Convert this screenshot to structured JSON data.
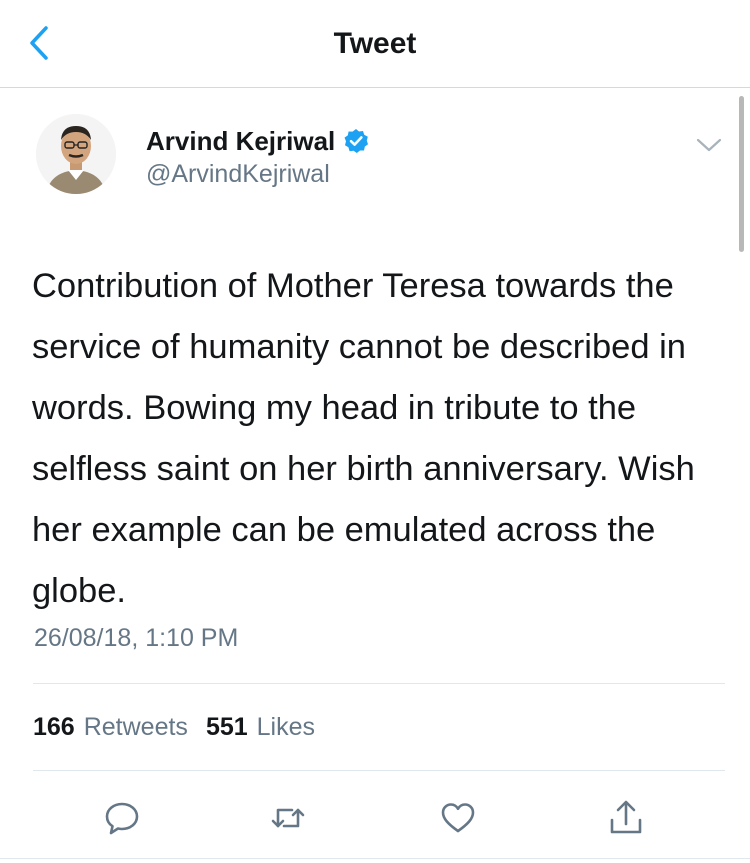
{
  "nav": {
    "title": "Tweet"
  },
  "author": {
    "name": "Arvind Kejriwal",
    "handle": "@ArvindKejriwal",
    "verified": true
  },
  "tweet": {
    "text": "Contribution of Mother Teresa towards the service of humanity cannot be described in words. Bowing my head in tribute to the selfless saint on her birth anniversary. Wish her example can be emulated across the globe.",
    "timestamp": "26/08/18, 1:10 PM"
  },
  "stats": {
    "retweets_count": "166",
    "retweets_label": "Retweets",
    "likes_count": "551",
    "likes_label": "Likes"
  },
  "actions": [
    "reply-icon",
    "retweet-icon",
    "like-icon",
    "share-icon"
  ],
  "colors": {
    "accent": "#1da1f2",
    "text": "#14171a",
    "muted": "#657786",
    "divider": "#e1e8ed"
  }
}
